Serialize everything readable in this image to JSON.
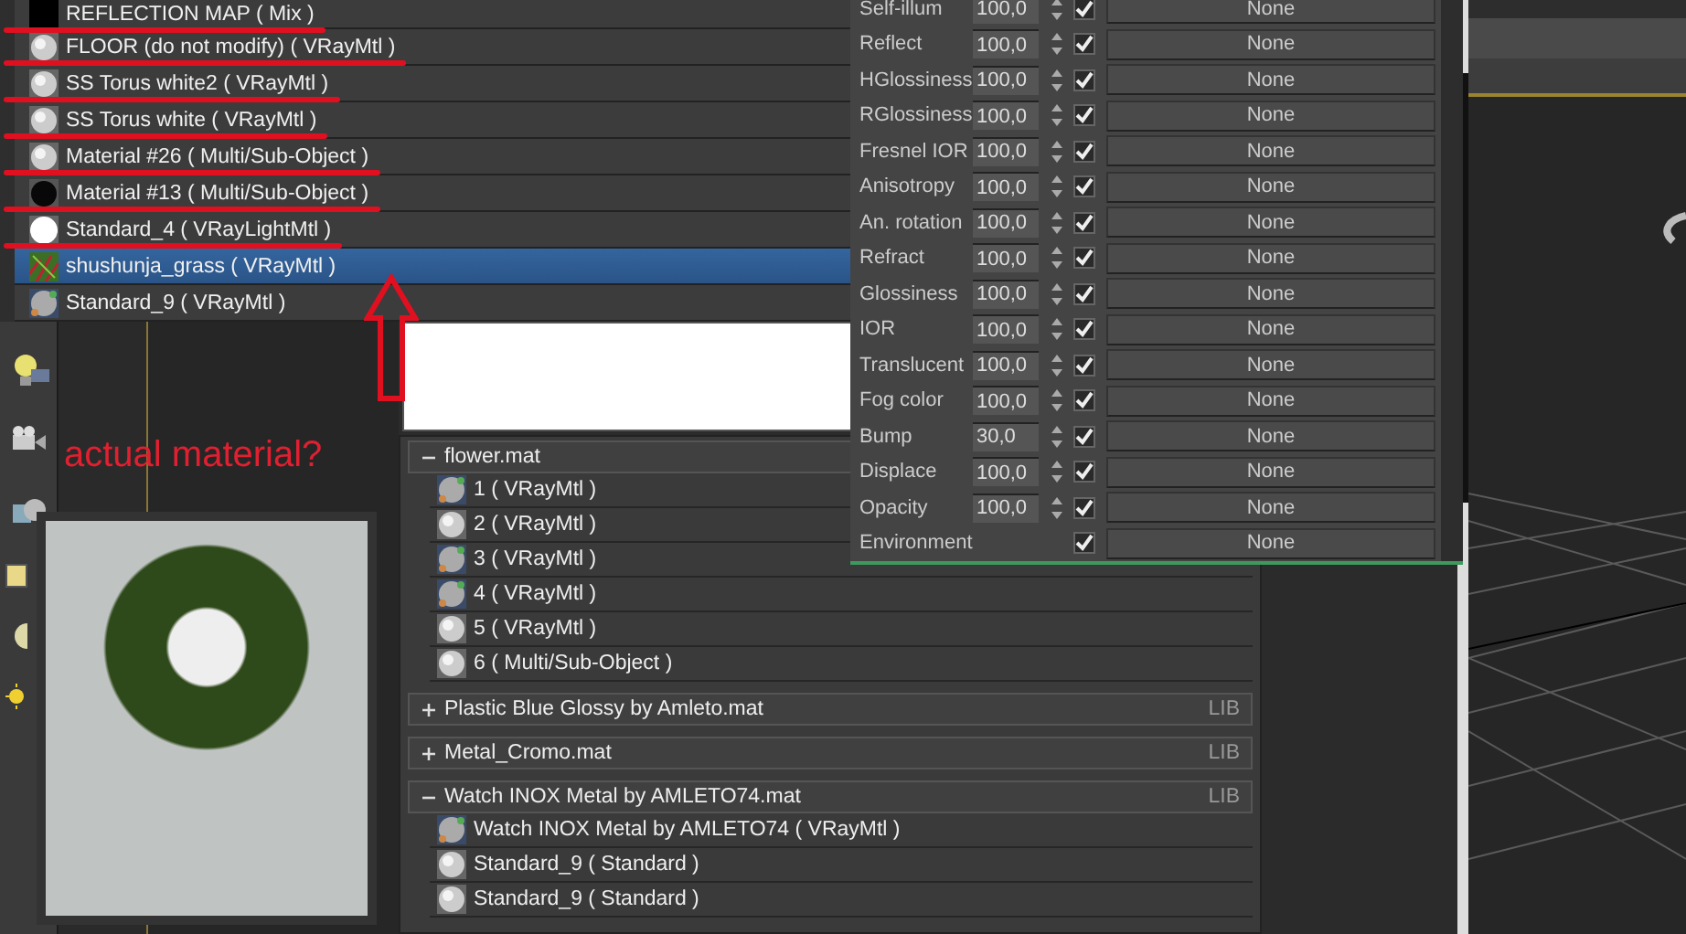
{
  "materials": [
    {
      "label": "REFLECTION MAP  ( Mix )",
      "kind": "map",
      "selected": false,
      "underlined": true
    },
    {
      "label": "FLOOR (do not modify)  ( VRayMtl )",
      "kind": "sphere",
      "selected": false,
      "underlined": true
    },
    {
      "label": "SS Torus white2  ( VRayMtl )",
      "kind": "sphere",
      "selected": false,
      "underlined": true
    },
    {
      "label": "SS Torus white  ( VRayMtl )",
      "kind": "sphere",
      "selected": false,
      "underlined": true
    },
    {
      "label": "Material #26  ( Multi/Sub-Object )",
      "kind": "sphere",
      "selected": false,
      "underlined": true
    },
    {
      "label": "Material #13  ( Multi/Sub-Object )",
      "kind": "dark",
      "selected": false,
      "underlined": true
    },
    {
      "label": "Standard_4  ( VRayLightMtl )",
      "kind": "light",
      "selected": false,
      "underlined": true
    },
    {
      "label": "shushunja_grass  ( VRayMtl )",
      "kind": "grass",
      "selected": true,
      "underlined": false
    },
    {
      "label": "Standard_9  ( VRayMtl )",
      "kind": "mixed",
      "selected": false,
      "underlined": false
    }
  ],
  "params": [
    {
      "label": "Self-illum",
      "value": "100,0",
      "checked": true,
      "map": "None"
    },
    {
      "label": "Reflect",
      "value": "100,0",
      "checked": true,
      "map": "None"
    },
    {
      "label": "HGlossiness",
      "value": "100,0",
      "checked": true,
      "map": "None"
    },
    {
      "label": "RGlossiness",
      "value": "100,0",
      "checked": true,
      "map": "None"
    },
    {
      "label": "Fresnel IOR",
      "value": "100,0",
      "checked": true,
      "map": "None"
    },
    {
      "label": "Anisotropy",
      "value": "100,0",
      "checked": true,
      "map": "None"
    },
    {
      "label": "An. rotation",
      "value": "100,0",
      "checked": true,
      "map": "None"
    },
    {
      "label": "Refract",
      "value": "100,0",
      "checked": true,
      "map": "None"
    },
    {
      "label": "Glossiness",
      "value": "100,0",
      "checked": true,
      "map": "None"
    },
    {
      "label": "IOR",
      "value": "100,0",
      "checked": true,
      "map": "None"
    },
    {
      "label": "Translucent",
      "value": "100,0",
      "checked": true,
      "map": "None"
    },
    {
      "label": "Fog color",
      "value": "100,0",
      "checked": true,
      "map": "None"
    },
    {
      "label": "Bump",
      "value": "30,0",
      "checked": true,
      "map": "None"
    },
    {
      "label": "Displace",
      "value": "100,0",
      "checked": true,
      "map": "None"
    },
    {
      "label": "Opacity",
      "value": "100,0",
      "checked": true,
      "map": "None"
    },
    {
      "label": "Environment",
      "checked": true,
      "map": "None"
    }
  ],
  "annotation": "actual material?",
  "library": [
    {
      "label": "flower.mat",
      "expanded": true,
      "items": [
        {
          "label": "1  ( VRayMtl )",
          "kind": "mixed"
        },
        {
          "label": "2  ( VRayMtl )",
          "kind": "sphere"
        },
        {
          "label": "3  ( VRayMtl )",
          "kind": "mixed"
        },
        {
          "label": "4  ( VRayMtl )",
          "kind": "mixed"
        },
        {
          "label": "5  ( VRayMtl )",
          "kind": "sphere"
        },
        {
          "label": "6  ( Multi/Sub-Object )",
          "kind": "sphere"
        }
      ]
    },
    {
      "label": "Plastic Blue Glossy by Amleto.mat",
      "expanded": false,
      "lib": "LIB"
    },
    {
      "label": "Metal_Cromo.mat",
      "expanded": false,
      "lib": "LIB"
    },
    {
      "label": "Watch INOX Metal by AMLETO74.mat",
      "expanded": true,
      "lib": "LIB",
      "items": [
        {
          "label": "Watch INOX Metal by AMLETO74  ( VRayMtl )",
          "kind": "mixed"
        },
        {
          "label": "Standard_9  ( Standard )",
          "kind": "sphere"
        },
        {
          "label": "Standard_9  ( Standard )",
          "kind": "sphere"
        }
      ]
    }
  ]
}
